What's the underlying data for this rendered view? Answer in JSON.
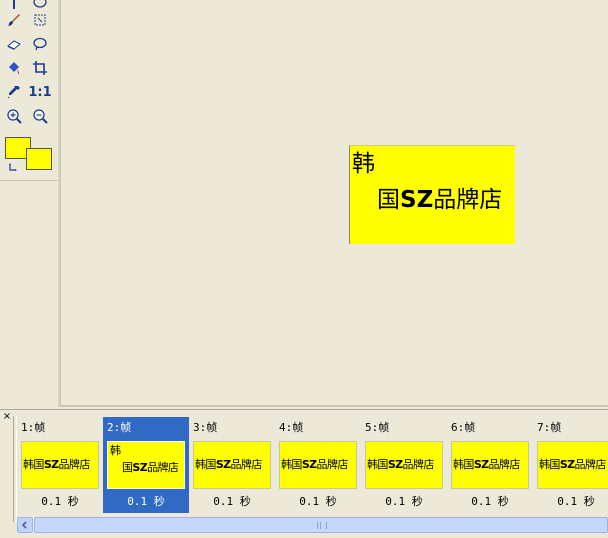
{
  "toolbox": {
    "tools": [
      {
        "name": "text-tool-icon"
      },
      {
        "name": "ellipse-tool-icon"
      },
      {
        "name": "brush-tool-icon"
      },
      {
        "name": "magic-lasso-tool-icon"
      },
      {
        "name": "eraser-tool-icon"
      },
      {
        "name": "lasso-tool-icon"
      },
      {
        "name": "fill-bucket-tool-icon"
      },
      {
        "name": "crop-tool-icon"
      },
      {
        "name": "eyedropper-tool-icon"
      },
      {
        "name": "actual-size-tool-icon"
      },
      {
        "name": "zoom-in-tool-icon"
      },
      {
        "name": "zoom-out-tool-icon"
      }
    ],
    "actual_size_label": "1:1",
    "foreground_color": "#ffff00",
    "background_color": "#ffff00"
  },
  "canvas": {
    "image_line1": "韩",
    "image_line2_prefix": "国",
    "image_line2_bold": "SZ",
    "image_line2_suffix": "品牌店",
    "image_bg_color": "#ffff00"
  },
  "animation": {
    "frames": [
      {
        "label": "1:帧",
        "thumb_prefix": "韩国",
        "thumb_bold": "SZ",
        "thumb_suffix": "品牌店",
        "delay": "0.1 秒",
        "selected": false
      },
      {
        "label": "2:帧",
        "thumb_line1": "韩",
        "thumb_prefix": "国",
        "thumb_bold": "SZ",
        "thumb_suffix": "品牌店",
        "delay": "0.1 秒",
        "selected": true
      },
      {
        "label": "3:帧",
        "thumb_prefix": "韩国",
        "thumb_bold": "SZ",
        "thumb_suffix": "品牌店",
        "delay": "0.1 秒",
        "selected": false
      },
      {
        "label": "4:帧",
        "thumb_prefix": "韩国",
        "thumb_bold": "SZ",
        "thumb_suffix": "品牌店",
        "delay": "0.1 秒",
        "selected": false
      },
      {
        "label": "5:帧",
        "thumb_prefix": "韩国",
        "thumb_bold": "SZ",
        "thumb_suffix": "品牌店",
        "delay": "0.1 秒",
        "selected": false
      },
      {
        "label": "6:帧",
        "thumb_prefix": "韩国",
        "thumb_bold": "SZ",
        "thumb_suffix": "品牌店",
        "delay": "0.1 秒",
        "selected": false
      },
      {
        "label": "7:帧",
        "thumb_prefix": "韩国",
        "thumb_bold": "SZ",
        "thumb_suffix": "品牌店",
        "delay": "0.1 秒",
        "selected": false
      }
    ],
    "close_glyph": "×",
    "selection_color": "#316ac5"
  }
}
